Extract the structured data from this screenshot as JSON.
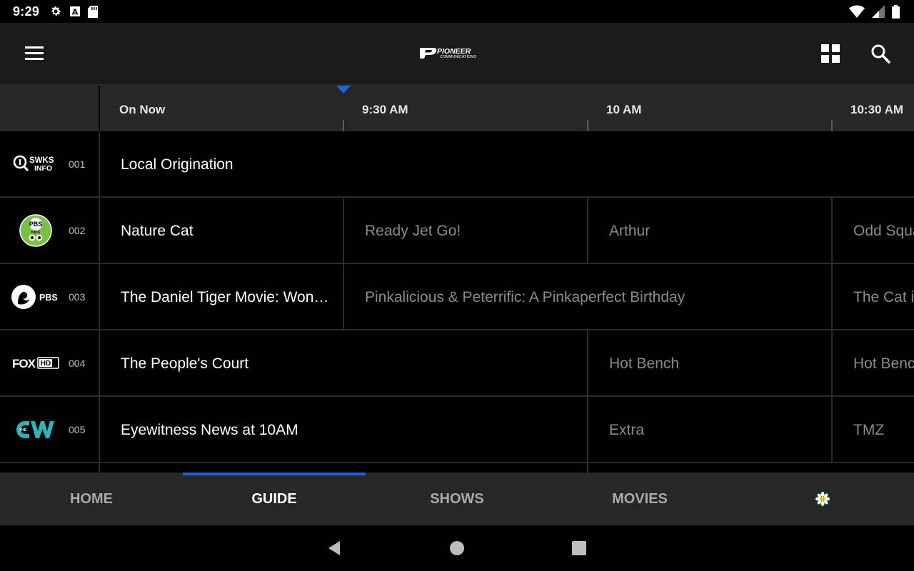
{
  "status": {
    "time": "9:29",
    "left_icons": [
      "gear-icon",
      "font-a-icon",
      "sd-card-icon"
    ],
    "right_icons": [
      "wifi-icon",
      "cellular-icon",
      "battery-icon"
    ]
  },
  "header": {
    "logo_text": "PIONEER",
    "logo_subtext": "COMMUNICATIONS",
    "icons": [
      "menu-icon",
      "grid-icon",
      "search-icon"
    ]
  },
  "timeline": {
    "slots": [
      "On Now",
      "9:30 AM",
      "10 AM",
      "10:30 AM"
    ]
  },
  "channels": [
    {
      "number": "001",
      "logo_text": "SWKS INFO",
      "programs": [
        {
          "title": "Local Origination"
        }
      ]
    },
    {
      "number": "002",
      "logo_text": "PBS KIDS",
      "programs": [
        {
          "title": "Nature Cat"
        },
        {
          "title": "Ready Jet Go!"
        },
        {
          "title": "Arthur"
        },
        {
          "title": "Odd Squad"
        }
      ]
    },
    {
      "number": "003",
      "logo_text": "PBS",
      "programs": [
        {
          "title": "The Daniel Tiger Movie: Won…"
        },
        {
          "title": "Pinkalicious & Peterrific: A Pinkaperfect Birthday"
        },
        {
          "title": "The Cat in the Hat"
        }
      ]
    },
    {
      "number": "004",
      "logo_text": "FOX HD",
      "programs": [
        {
          "title": "The People's Court"
        },
        {
          "title": "Hot Bench"
        },
        {
          "title": "Hot Bench"
        }
      ]
    },
    {
      "number": "005",
      "logo_text": "THE CW",
      "programs": [
        {
          "title": "Eyewitness News at 10AM"
        },
        {
          "title": "Extra"
        },
        {
          "title": "TMZ"
        }
      ]
    }
  ],
  "bottom_nav": {
    "tabs": [
      "HOME",
      "GUIDE",
      "SHOWS",
      "MOVIES"
    ],
    "active": "GUIDE",
    "profile_icon": "flower-avatar-icon"
  },
  "colors": {
    "accent": "#2264d1",
    "app_bar": "#1b1b1b",
    "header_bg": "#272727",
    "cw_teal": "#2ab3b8",
    "pbs_kids_green": "#7ac143"
  }
}
